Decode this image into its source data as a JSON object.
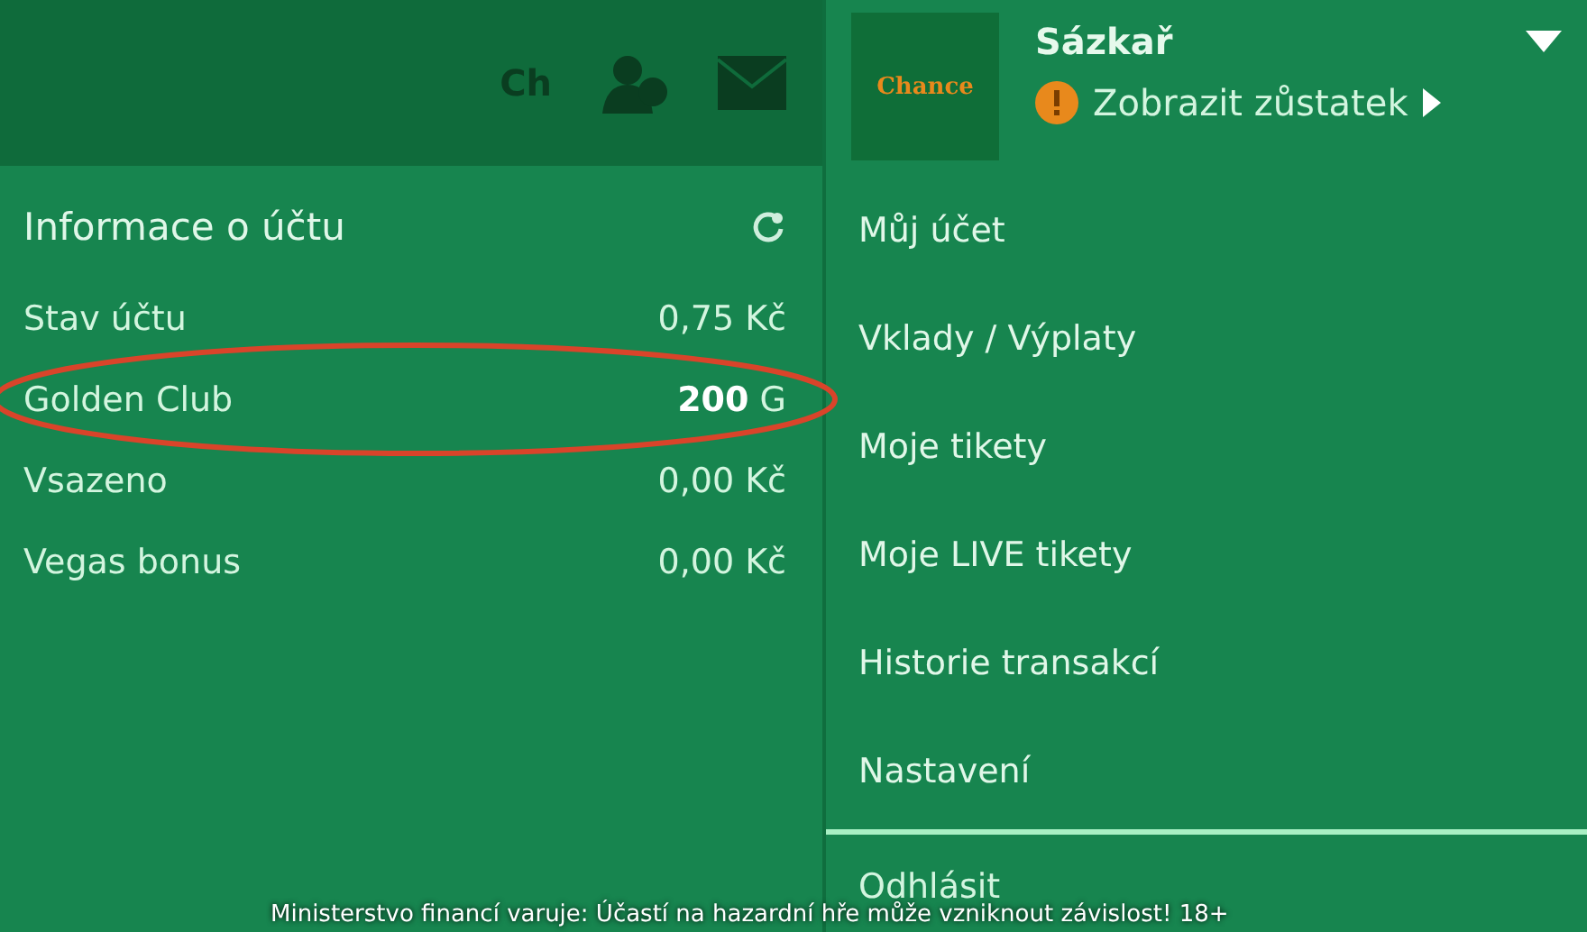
{
  "toolbar": {
    "logo_text": "Ch"
  },
  "account_info": {
    "title": "Informace o účtu",
    "rows": [
      {
        "label": "Stav účtu",
        "value": "0,75 Kč",
        "highlighted": false
      },
      {
        "label": "Golden Club",
        "value": "**200** G",
        "highlighted": true
      },
      {
        "label": "Vsazeno",
        "value": "0,00 Kč",
        "highlighted": false
      },
      {
        "label": "Vegas bonus",
        "value": "0,00 Kč",
        "highlighted": false
      }
    ]
  },
  "user_menu": {
    "brand": "Chance",
    "username": "Sázkař",
    "balance_link": "Zobrazit zůstatek",
    "expanded": true,
    "items": [
      {
        "label": "Můj účet"
      },
      {
        "label": "Vklady / Výplaty"
      },
      {
        "label": "Moje tikety"
      },
      {
        "label": "Moje LIVE tikety"
      },
      {
        "label": "Historie transakcí"
      },
      {
        "label": "Nastavení"
      }
    ],
    "logout": "Odhlásit"
  },
  "warning": "Ministerstvo financí varuje: Účastí na hazardní hře může vzniknout závislost! 18+"
}
